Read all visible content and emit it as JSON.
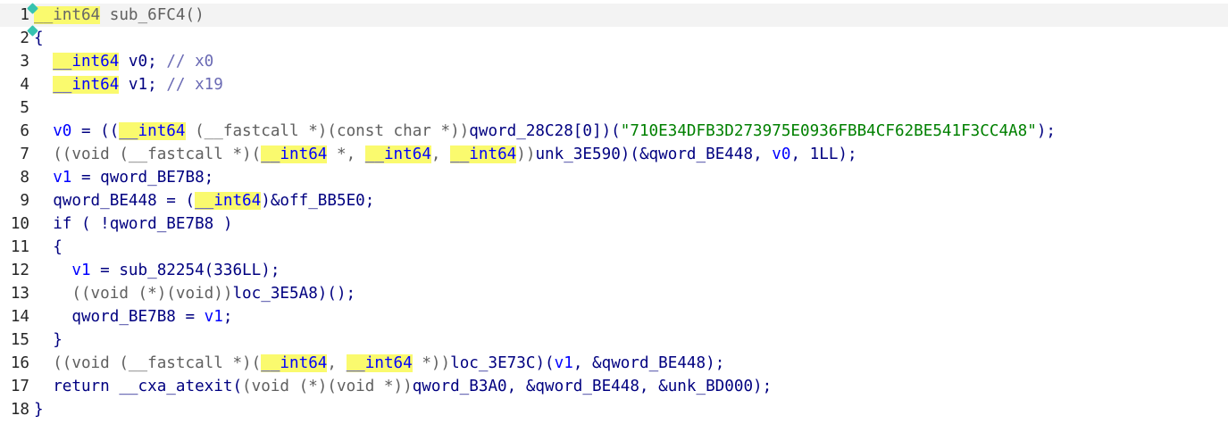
{
  "editor": {
    "line_numbers": [
      "1",
      "2",
      "3",
      "4",
      "5",
      "6",
      "7",
      "8",
      "9",
      "10",
      "11",
      "12",
      "13",
      "14",
      "15",
      "16",
      "17",
      "18"
    ],
    "lines": [
      {
        "segs": [
          {
            "t": "type-gray",
            "v": "__int64"
          },
          {
            "t": "gray",
            "v": " sub_6FC4()"
          }
        ]
      },
      {
        "segs": [
          {
            "t": "punc",
            "v": "{"
          }
        ]
      },
      {
        "segs": [
          {
            "t": "plain",
            "v": "  "
          },
          {
            "t": "type",
            "v": "__int64"
          },
          {
            "t": "ident",
            "v": " v0; "
          },
          {
            "t": "com",
            "v": "// x0"
          }
        ]
      },
      {
        "segs": [
          {
            "t": "plain",
            "v": "  "
          },
          {
            "t": "type",
            "v": "__int64"
          },
          {
            "t": "ident",
            "v": " v1; "
          },
          {
            "t": "com",
            "v": "// x19"
          }
        ]
      },
      {
        "segs": []
      },
      {
        "segs": [
          {
            "t": "plain",
            "v": "  "
          },
          {
            "t": "var",
            "v": "v0"
          },
          {
            "t": "ident",
            "v": " = (("
          },
          {
            "t": "type",
            "v": "__int64"
          },
          {
            "t": "gray",
            "v": " (__fastcall *)(const char *))"
          },
          {
            "t": "ident",
            "v": "qword_28C28[0])("
          },
          {
            "t": "str",
            "v": "\"710E34DFB3D273975E0936FBB4CF62BE541F3CC4A8\""
          },
          {
            "t": "ident",
            "v": ");"
          }
        ]
      },
      {
        "segs": [
          {
            "t": "plain",
            "v": "  "
          },
          {
            "t": "gray",
            "v": "((void (__fastcall *)("
          },
          {
            "t": "type",
            "v": "__int64"
          },
          {
            "t": "gray",
            "v": " *, "
          },
          {
            "t": "type",
            "v": "__int64"
          },
          {
            "t": "gray",
            "v": ", "
          },
          {
            "t": "type",
            "v": "__int64"
          },
          {
            "t": "gray",
            "v": "))"
          },
          {
            "t": "ident",
            "v": "unk_3E590)(&qword_BE448, "
          },
          {
            "t": "var",
            "v": "v0"
          },
          {
            "t": "ident",
            "v": ", 1LL);"
          }
        ]
      },
      {
        "segs": [
          {
            "t": "plain",
            "v": "  "
          },
          {
            "t": "var",
            "v": "v1"
          },
          {
            "t": "ident",
            "v": " = qword_BE7B8;"
          }
        ]
      },
      {
        "segs": [
          {
            "t": "plain",
            "v": "  "
          },
          {
            "t": "ident",
            "v": "qword_BE448 = ("
          },
          {
            "t": "type",
            "v": "__int64"
          },
          {
            "t": "ident",
            "v": ")&off_BB5E0;"
          }
        ]
      },
      {
        "segs": [
          {
            "t": "plain",
            "v": "  "
          },
          {
            "t": "ident",
            "v": "if ( !qword_BE7B8 )"
          }
        ]
      },
      {
        "segs": [
          {
            "t": "plain",
            "v": "  "
          },
          {
            "t": "ident",
            "v": "{"
          }
        ]
      },
      {
        "segs": [
          {
            "t": "plain",
            "v": "    "
          },
          {
            "t": "var",
            "v": "v1"
          },
          {
            "t": "ident",
            "v": " = sub_82254(336LL);"
          }
        ]
      },
      {
        "segs": [
          {
            "t": "plain",
            "v": "    "
          },
          {
            "t": "gray",
            "v": "((void (*)(void))"
          },
          {
            "t": "ident",
            "v": "loc_3E5A8)();"
          }
        ]
      },
      {
        "segs": [
          {
            "t": "plain",
            "v": "    "
          },
          {
            "t": "ident",
            "v": "qword_BE7B8 = "
          },
          {
            "t": "var",
            "v": "v1"
          },
          {
            "t": "ident",
            "v": ";"
          }
        ]
      },
      {
        "segs": [
          {
            "t": "plain",
            "v": "  "
          },
          {
            "t": "ident",
            "v": "}"
          }
        ]
      },
      {
        "segs": [
          {
            "t": "plain",
            "v": "  "
          },
          {
            "t": "gray",
            "v": "((void (__fastcall *)("
          },
          {
            "t": "type",
            "v": "__int64"
          },
          {
            "t": "gray",
            "v": ", "
          },
          {
            "t": "type",
            "v": "__int64"
          },
          {
            "t": "gray",
            "v": " *))"
          },
          {
            "t": "ident",
            "v": "loc_3E73C)("
          },
          {
            "t": "var",
            "v": "v1"
          },
          {
            "t": "ident",
            "v": ", &qword_BE448);"
          }
        ]
      },
      {
        "segs": [
          {
            "t": "plain",
            "v": "  "
          },
          {
            "t": "ident",
            "v": "return __cxa_atexit("
          },
          {
            "t": "gray",
            "v": "(void (*)(void *))"
          },
          {
            "t": "ident",
            "v": "qword_B3A0, &qword_BE448, &unk_BD000);"
          }
        ]
      },
      {
        "segs": [
          {
            "t": "punc",
            "v": "}"
          }
        ]
      }
    ]
  },
  "colors": {
    "background": "#ffffff",
    "current_line": "#f3f3f3",
    "highlight": "#fafa6e",
    "identifier": "#000080",
    "variable": "#0000ff",
    "comment": "#6a6ab4",
    "string": "#008000",
    "cast_gray": "#606060",
    "marker": "#36c3b0"
  }
}
